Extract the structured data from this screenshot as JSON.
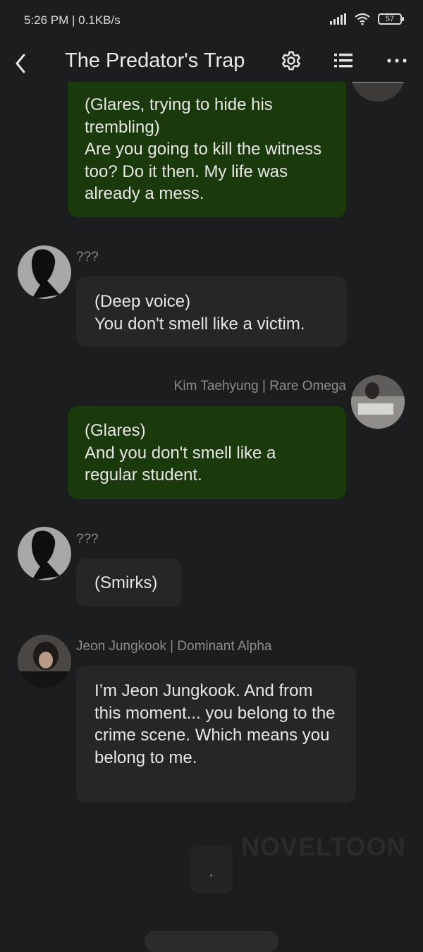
{
  "status_bar": {
    "time": "5:26 PM | 0.1KB/s",
    "battery": "57"
  },
  "header": {
    "title": "The Predator's Trap"
  },
  "messages": [
    {
      "sender": "",
      "text": "(Glares, trying to hide his trembling)\nAre you going to kill the witness too? Do it then. My life was already a mess."
    },
    {
      "sender": "???",
      "text": "(Deep voice)\nYou don't smell like a victim."
    },
    {
      "sender": "Kim Taehyung | Rare Omega",
      "text": "(Glares)\nAnd you don't smell like a regular student."
    },
    {
      "sender": "???",
      "text": "(Smirks)"
    },
    {
      "sender": "Jeon Jungkook | Dominant Alpha",
      "text": "I’m Jeon Jungkook. And from this moment... you belong to the crime scene. Which means you belong to me."
    }
  ],
  "watermark": "NOVELTOON",
  "icons": [
    "back-icon",
    "settings-icon",
    "list-icon",
    "more-icon",
    "signal-icon",
    "wifi-icon",
    "battery-icon"
  ]
}
